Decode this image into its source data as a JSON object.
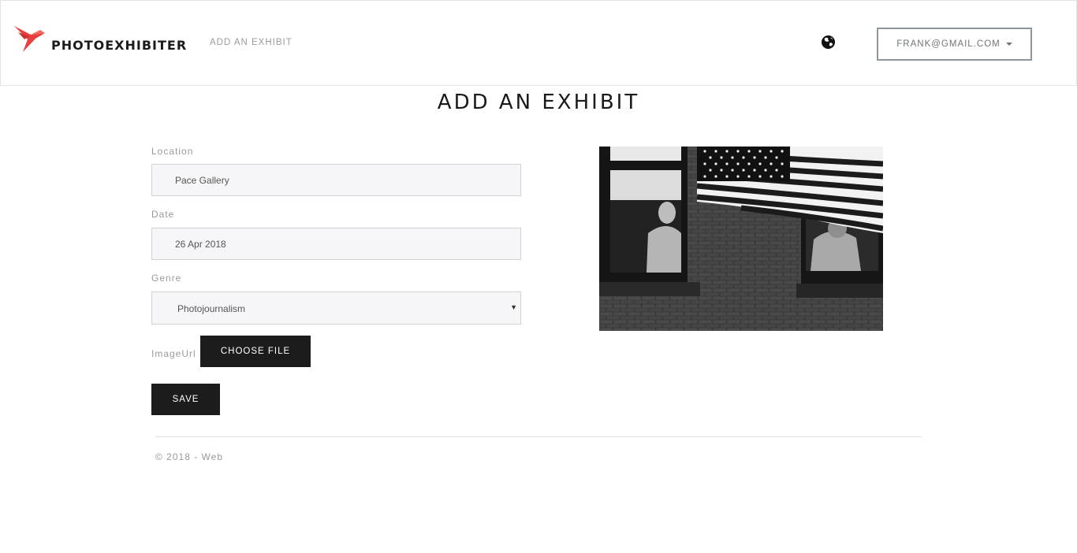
{
  "header": {
    "brand": "PHOTOEXHIBITER",
    "nav_link": "ADD AN EXHIBIT",
    "user_menu": "FRANK@GMAIL.COM",
    "globe_icon": "globe-icon",
    "logo_icon": "bird-logo-icon",
    "accent_color": "#e8403f"
  },
  "page": {
    "title": "ADD AN EXHIBIT"
  },
  "form": {
    "location_label": "Location",
    "location_value": "Pace Gallery",
    "date_label": "Date",
    "date_value": "26 Apr 2018",
    "genre_label": "Genre",
    "genre_value": "Photojournalism",
    "imageurl_label": "ImageUrl",
    "choose_file_label": "CHOOSE FILE",
    "save_label": "SAVE"
  },
  "footer": {
    "text": "© 2018 - Web"
  }
}
